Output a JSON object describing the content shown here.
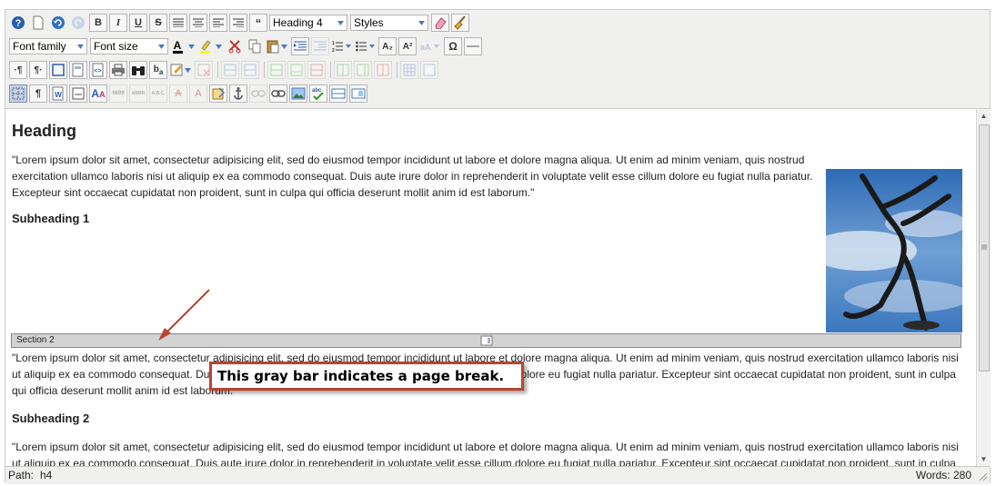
{
  "toolbar": {
    "format_select": "Heading 4",
    "styles_select": "Styles",
    "font_family_select": "Font family",
    "font_size_select": "Font size"
  },
  "document": {
    "heading": "Heading",
    "paragraph1": "\"Lorem ipsum dolor sit amet, consectetur adipisicing elit, sed do eiusmod tempor incididunt ut labore et dolore magna aliqua. Ut enim ad minim veniam, quis nostrud exercitation ullamco laboris nisi ut aliquip ex ea commodo consequat. Duis aute irure dolor in reprehenderit in voluptate velit esse cillum dolore eu fugiat nulla pariatur. Excepteur sint occaecat cupidatat non proident, sunt in culpa qui officia deserunt mollit anim id est laborum.\"",
    "subheading1": "Subheading 1",
    "page_break_label": "Section 2",
    "paragraph2": "\"Lorem ipsum dolor sit amet, consectetur adipisicing elit, sed do eiusmod tempor incididunt ut labore et dolore magna aliqua. Ut enim ad minim veniam, quis nostrud exercitation ullamco laboris nisi ut aliquip ex ea commodo consequat. Duis aute irure dolor in reprehenderit in voluptate velit esse cillum dolore eu fugiat nulla pariatur. Excepteur sint occaecat cupidatat non proident, sunt in culpa qui officia deserunt mollit anim id est laborum.\"",
    "subheading2": "Subheading 2",
    "paragraph3": "\"Lorem ipsum dolor sit amet, consectetur adipisicing elit, sed do eiusmod tempor incididunt ut labore et dolore magna aliqua. Ut enim ad minim veniam, quis nostrud exercitation ullamco laboris nisi ut aliquip ex ea commodo consequat. Duis aute irure dolor in reprehenderit in voluptate velit esse cillum dolore eu fugiat nulla pariatur. Excepteur sint occaecat cupidatat non proident, sunt in culpa qui officia deserunt mollit anim id est laborum.\""
  },
  "callout": {
    "text": "This gray bar indicates a page break."
  },
  "status": {
    "path_label": "Path:",
    "path_value": "h4",
    "words": "Words: 280"
  },
  "colors": {
    "callout_border": "#b8452e",
    "page_break_bg": "#d3d3d3",
    "toolbar_bg": "#f0f0ee"
  }
}
